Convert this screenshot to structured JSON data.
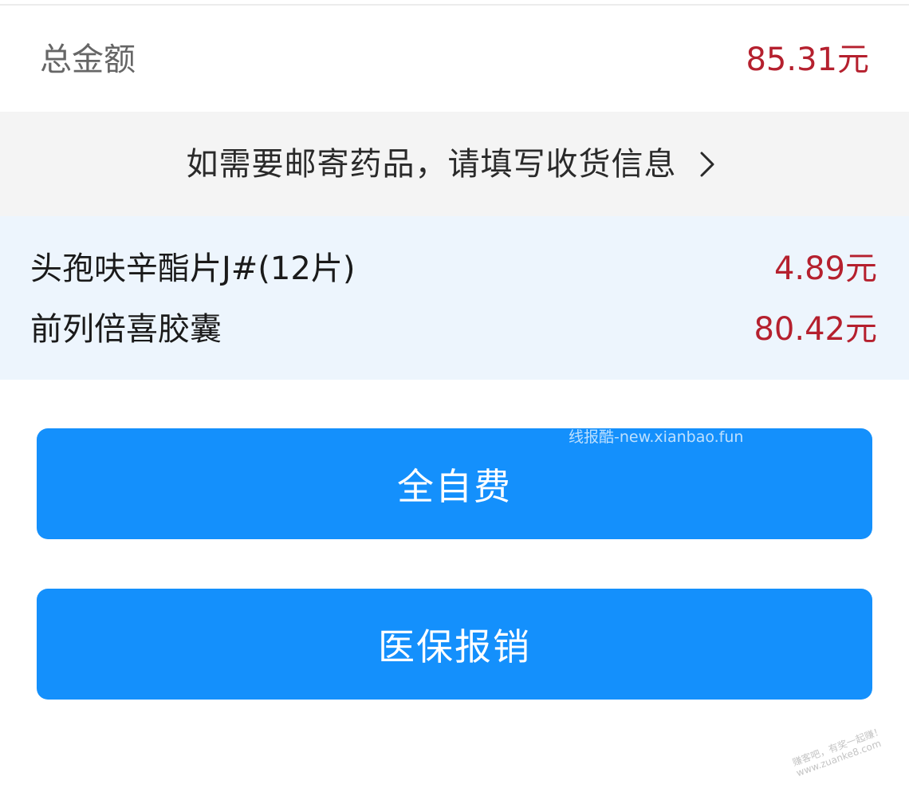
{
  "summary": {
    "total_label": "总金额",
    "total_value": "85.31元"
  },
  "shipping": {
    "prompt": "如需要邮寄药品，请填写收货信息",
    "icon": "chevron-right-icon"
  },
  "drugs": [
    {
      "name": "头孢呋辛酯片J#(12片)",
      "price": "4.89元"
    },
    {
      "name": "前列倍喜胶囊",
      "price": "80.42元"
    }
  ],
  "actions": {
    "self_pay_label": "全自费",
    "insurance_label": "医保报销"
  },
  "watermarks": {
    "top": "线报酷-new.xianbao.fun",
    "corner_line1": "赚客吧，有奖一起赚！",
    "corner_line2": "www.zuanke8.com"
  },
  "colors": {
    "price_red": "#b5202e",
    "button_blue": "#1490fc",
    "drug_list_bg": "#edf5fd",
    "shipping_bg": "#f4f4f4"
  }
}
